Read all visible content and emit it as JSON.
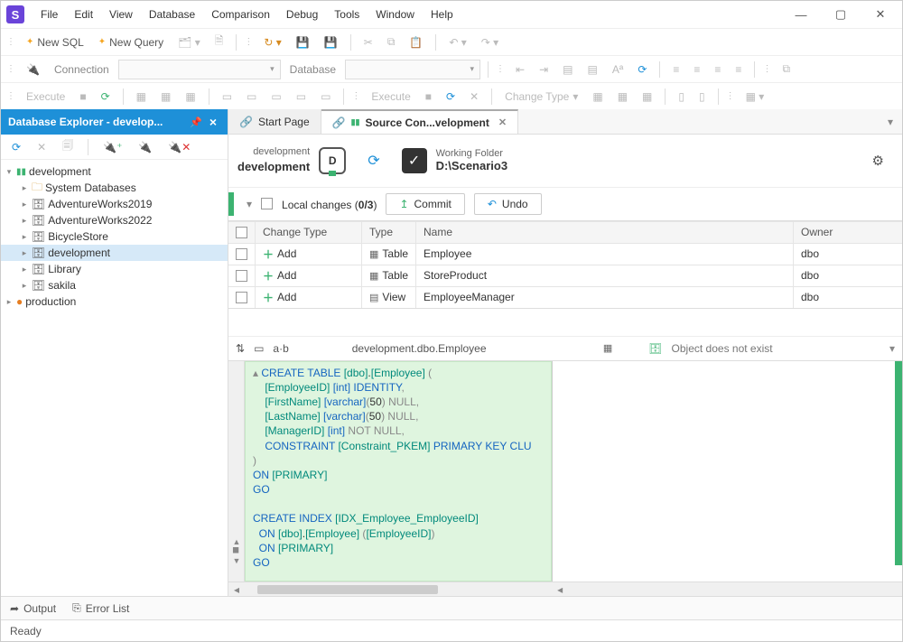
{
  "menu": [
    "File",
    "Edit",
    "View",
    "Database",
    "Comparison",
    "Debug",
    "Tools",
    "Window",
    "Help"
  ],
  "toolbar1": {
    "newSql": "New SQL",
    "newQuery": "New Query"
  },
  "toolbar2": {
    "connection": "Connection",
    "database": "Database"
  },
  "toolbar3": {
    "execute": "Execute",
    "execute2": "Execute",
    "changeType": "Change Type"
  },
  "explorer": {
    "title": "Database Explorer - develop...",
    "servers": [
      {
        "name": "development",
        "expanded": true,
        "color": "green",
        "children": [
          {
            "name": "System Databases",
            "icon": "folder"
          },
          {
            "name": "AdventureWorks2019",
            "icon": "db"
          },
          {
            "name": "AdventureWorks2022",
            "icon": "db"
          },
          {
            "name": "BicycleStore",
            "icon": "db"
          },
          {
            "name": "development",
            "icon": "db",
            "selected": true
          },
          {
            "name": "Library",
            "icon": "db"
          },
          {
            "name": "sakila",
            "icon": "db"
          }
        ]
      },
      {
        "name": "production",
        "expanded": false,
        "color": "orange"
      }
    ]
  },
  "tabs": {
    "startPage": "Start Page",
    "sourceControl": "Source Con...velopment"
  },
  "sc": {
    "leftSub": "development",
    "leftMain": "development",
    "rightSub": "Working Folder",
    "rightMain": "D:\\Scenario3"
  },
  "changes": {
    "label": "Local changes (",
    "count": "0/3",
    "labelEnd": ")",
    "commit": "Commit",
    "undo": "Undo"
  },
  "grid": {
    "headers": {
      "change": "Change Type",
      "type": "Type",
      "name": "Name",
      "owner": "Owner"
    },
    "rows": [
      {
        "change": "Add",
        "type": "Table",
        "name": "Employee",
        "owner": "dbo"
      },
      {
        "change": "Add",
        "type": "Table",
        "name": "StoreProduct",
        "owner": "dbo"
      },
      {
        "change": "Add",
        "type": "View",
        "name": "EmployeeManager",
        "owner": "dbo"
      }
    ]
  },
  "diff": {
    "crumb": "development.dbo.Employee",
    "noexist": "Object does not exist",
    "ab": "a·b"
  },
  "sql": {
    "l1a": "CREATE TABLE ",
    "l1b": "[dbo]",
    "l1c": ".",
    "l1d": "[Employee]",
    "l1e": " (",
    "l2a": "    ",
    "l2b": "[EmployeeID]",
    "l2c": " ",
    "l2d": "[int]",
    "l2e": " IDENTITY",
    "l2f": ",",
    "l3a": "    ",
    "l3b": "[FirstName]",
    "l3c": " ",
    "l3d": "[varchar]",
    "l3e": "(",
    "l3f": "50",
    "l3g": ")",
    "l3h": " NULL",
    "l3i": ",",
    "l4a": "    ",
    "l4b": "[LastName]",
    "l4c": " ",
    "l4d": "[varchar]",
    "l4e": "(",
    "l4f": "50",
    "l4g": ")",
    "l4h": " NULL",
    "l4i": ",",
    "l5a": "    ",
    "l5b": "[ManagerID]",
    "l5c": " ",
    "l5d": "[int]",
    "l5e": " NOT NULL",
    "l5f": ",",
    "l6a": "    ",
    "l6b": "CONSTRAINT ",
    "l6c": "[Constraint_PKEM]",
    "l6d": " PRIMARY KEY CLU",
    "l7": ")",
    "l8a": "ON ",
    "l8b": "[PRIMARY]",
    "l9": "GO",
    "l11a": "CREATE INDEX ",
    "l11b": "[IDX_Employee_EmployeeID]",
    "l12a": "  ",
    "l12b": "ON ",
    "l12c": "[dbo]",
    "l12d": ".",
    "l12e": "[Employee]",
    "l12f": " (",
    "l12g": "[EmployeeID]",
    "l12h": ")",
    "l13a": "  ",
    "l13b": "ON ",
    "l13c": "[PRIMARY]",
    "l14": "GO"
  },
  "bottom": {
    "output": "Output",
    "errorList": "Error List"
  },
  "status": "Ready"
}
